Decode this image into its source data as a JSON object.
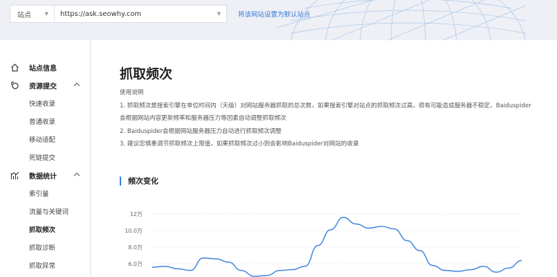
{
  "topbar": {
    "site_type": "站点",
    "site_url": "https://ask.seowhy.com",
    "set_default_link": "将该网站设置为默认站点"
  },
  "sidebar": {
    "groups": [
      {
        "label": "站点信息",
        "icon": "home-icon"
      },
      {
        "label": "资源提交",
        "icon": "link-icon",
        "items": [
          "快速收录",
          "普通收录",
          "移动适配",
          "死链提交"
        ]
      },
      {
        "label": "数据统计",
        "icon": "chart-icon",
        "items": [
          "索引量",
          "流量与关键词",
          "抓取频次",
          "抓取诊断",
          "抓取异常"
        ]
      }
    ],
    "active_item": "抓取频次"
  },
  "main": {
    "title": "抓取频次",
    "description": [
      "使用说明",
      "1. 抓取频次是搜索引擎在单位时间内（天级）对网站服务器抓取的总次数，如果搜索引擎对站点的抓取频次过高，很有可能造成服务器不稳定，Baiduspider",
      "会根据网站内容更新频率和服务器压力等因素自动调整抓取频次",
      "2. Baiduspider会根据网站服务器压力自动进行抓取频次调整",
      "3. 建议您慎重调节抓取频次上限值，如果抓取频次过小则会影响Baiduspider对网站的收录"
    ],
    "section_title": "频次变化"
  },
  "chart_data": {
    "type": "line",
    "y_tick_labels": [
      "12万",
      "10.0万",
      "8.0万",
      "6.0万"
    ],
    "y_ticks": [
      120000,
      100000,
      80000,
      60000
    ],
    "ylim": [
      40000,
      120000
    ],
    "grid": true,
    "line_color": "#4a8ae0",
    "series": [
      {
        "values": [
          56000,
          57000,
          54000,
          52000,
          67000,
          66000,
          62000,
          52000,
          45000,
          46000,
          52000,
          53000,
          57000,
          82000,
          101000,
          116000,
          108000,
          103000,
          105000,
          102000,
          88000,
          76000,
          58000,
          52000,
          51000,
          53000,
          57000,
          50000,
          55000,
          64000
        ]
      }
    ]
  },
  "colors": {
    "accent": "#3a7ad9",
    "line": "#4a8ae0",
    "grid": "#dde2ea"
  }
}
